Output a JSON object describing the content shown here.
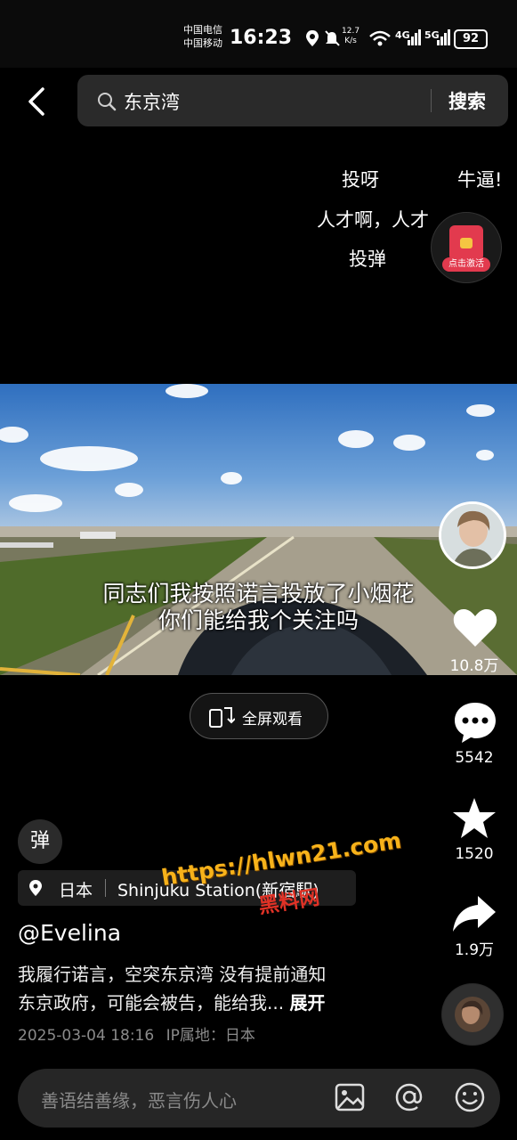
{
  "status_bar": {
    "carrier_1": "中国电信",
    "carrier_2": "中国移动",
    "time": "16:23",
    "speed_value": "12.7",
    "speed_unit": "K/s",
    "network_1": "4G",
    "network_2": "5G",
    "battery": "92"
  },
  "search": {
    "query": "东京湾",
    "button_label": "搜索"
  },
  "danmaku": [
    "投呀",
    "牛逼!",
    "人才啊，人才",
    "投弹"
  ],
  "hongbao": {
    "label": "点击激活"
  },
  "video": {
    "subtitle_line1": "同志们我按照诺言投放了小烟花",
    "subtitle_line2": "你们能给我个关注吗"
  },
  "fullscreen_button": "全屏观看",
  "actions": {
    "likes": "10.8万",
    "comments": "5542",
    "favorites": "1520",
    "shares": "1.9万"
  },
  "dan_toggle": "弹",
  "location": {
    "country": "日本",
    "place": "Shinjuku Station(新宿駅)"
  },
  "author": "@Evelina",
  "description_line1": "我履行诺言，空突东京湾 没有提前通知",
  "description_line2": "东京政府，可能会被告，能给我...",
  "expand_label": "展开",
  "post_time": "2025-03-04 18:16",
  "ip_location": "IP属地：日本",
  "watermark_url": "https://hlwn21.com",
  "watermark_name": "黑料网",
  "comment_placeholder": "善语结善缘，恶言伤人心",
  "colors": {
    "background": "#000000",
    "watermark": "#f7b21a",
    "hongbao": "#e23a4e"
  }
}
